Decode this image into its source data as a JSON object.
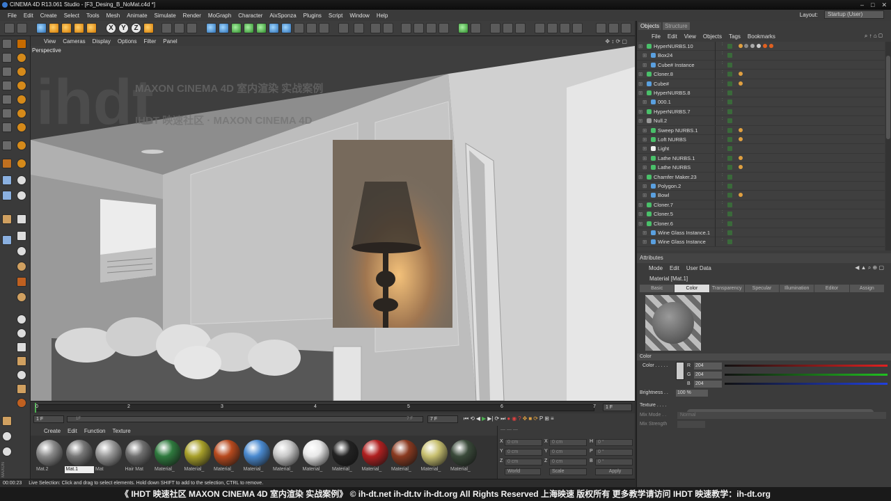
{
  "window": {
    "title": "CINEMA 4D R13.061 Studio - [F3_Desing_B_NoMat.c4d *]"
  },
  "menubar": [
    "File",
    "Edit",
    "Create",
    "Select",
    "Tools",
    "Mesh",
    "Animate",
    "Simulate",
    "Render",
    "MoGraph",
    "Character",
    "AixSponza",
    "Plugins",
    "Script",
    "Window",
    "Help"
  ],
  "layout": {
    "label": "Layout:",
    "value": "Startup (User)"
  },
  "viewport": {
    "menu": [
      "View",
      "Cameras",
      "Display",
      "Options",
      "Filter",
      "Panel"
    ],
    "label": "Perspective",
    "overlay_logo": "ihdt",
    "overlay_line1": "MAXON CINEMA 4D 室内渲染 实战案例",
    "overlay_line2": "IHDT 映速社区 · MAXON CINEMA 4D"
  },
  "timeline": {
    "ticks": [
      "0",
      "2",
      "3",
      "4",
      "5",
      "6",
      "7"
    ],
    "end_field": "1 F"
  },
  "transport": {
    "start_field": "1 F",
    "current_field": "7 F",
    "slider_start": "1F",
    "slider_end": "7 F"
  },
  "material_manager": {
    "menu": [
      "Create",
      "Edit",
      "Function",
      "Texture"
    ],
    "materials": [
      {
        "label": "Mat.2",
        "color": "#8a8a8a"
      },
      {
        "label": "Mat.1",
        "color": "#777"
      },
      {
        "label": "Mat",
        "color": "#999"
      },
      {
        "label": "Hair Mat",
        "color": "#6f6f6f"
      },
      {
        "label": "Material_",
        "color": "#2f7a3e"
      },
      {
        "label": "Material_",
        "color": "#a8a02a"
      },
      {
        "label": "Material_",
        "color": "#b84a1e"
      },
      {
        "label": "Material_",
        "color": "#4a8ad0"
      },
      {
        "label": "Material_",
        "color": "#c8c8c8"
      },
      {
        "label": "Material_",
        "color": "#e8e8e8"
      },
      {
        "label": "Material_",
        "color": "#222"
      },
      {
        "label": "Material_",
        "color": "#b02020"
      },
      {
        "label": "Material_",
        "color": "#8a3a20"
      },
      {
        "label": "Material_",
        "color": "#c8c070"
      },
      {
        "label": "Material_",
        "color": "#3a4a3a"
      }
    ],
    "selected_index": 1
  },
  "coords": {
    "rows": [
      {
        "a": "X",
        "b": "X",
        "c": "H"
      },
      {
        "a": "Y",
        "b": "Y",
        "c": "P"
      },
      {
        "a": "Z",
        "b": "Z",
        "c": "B"
      }
    ],
    "world": "World",
    "scale": "Scale",
    "apply": "Apply"
  },
  "status": {
    "time": "00:00:23",
    "text": "Live Selection: Click and drag to select elements. Hold down SHIFT to add to the selection, CTRL to remove."
  },
  "objects_panel": {
    "tabs": [
      "Objects",
      "Structure"
    ],
    "menu": [
      "File",
      "Edit",
      "View",
      "Objects",
      "Tags",
      "Bookmarks"
    ],
    "items": [
      {
        "name": "HyperNURBS.10",
        "depth": 0,
        "icon": "#4ac06a"
      },
      {
        "name": "Box24",
        "depth": 1,
        "icon": "#5aa0e0"
      },
      {
        "name": "Cube# Instance",
        "depth": 1,
        "icon": "#5aa0e0"
      },
      {
        "name": "Cloner.8",
        "depth": 0,
        "icon": "#4ac06a"
      },
      {
        "name": "Cube#",
        "depth": 0,
        "icon": "#5aa0e0"
      },
      {
        "name": "HyperNURBS.8",
        "depth": 0,
        "icon": "#4ac06a"
      },
      {
        "name": "000.1",
        "depth": 1,
        "icon": "#5aa0e0"
      },
      {
        "name": "HyperNURBS.7",
        "depth": 0,
        "icon": "#4ac06a"
      },
      {
        "name": "Null.2",
        "depth": 0,
        "icon": "#999"
      },
      {
        "name": "Sweep NURBS.1",
        "depth": 1,
        "icon": "#4ac06a"
      },
      {
        "name": "Loft NURBS",
        "depth": 1,
        "icon": "#4ac06a"
      },
      {
        "name": "Light",
        "depth": 1,
        "icon": "#eee"
      },
      {
        "name": "Lathe NURBS.1",
        "depth": 1,
        "icon": "#4ac06a"
      },
      {
        "name": "Lathe NURBS",
        "depth": 1,
        "icon": "#4ac06a"
      },
      {
        "name": "Chamfer Maker.23",
        "depth": 0,
        "icon": "#4ac06a"
      },
      {
        "name": "Polygon.2",
        "depth": 1,
        "icon": "#5aa0e0"
      },
      {
        "name": "Bowl",
        "depth": 1,
        "icon": "#5aa0e0"
      },
      {
        "name": "Cloner.7",
        "depth": 0,
        "icon": "#4ac06a"
      },
      {
        "name": "Cloner.5",
        "depth": 0,
        "icon": "#4ac06a"
      },
      {
        "name": "Cloner.6",
        "depth": 0,
        "icon": "#4ac06a"
      },
      {
        "name": "Wine Glass Instance.1",
        "depth": 1,
        "icon": "#5aa0e0"
      },
      {
        "name": "Wine Glass Instance",
        "depth": 1,
        "icon": "#5aa0e0"
      }
    ]
  },
  "attributes_panel": {
    "header": "Attributes",
    "menu": [
      "Mode",
      "Edit",
      "User Data"
    ],
    "material_title": "Material [Mat.1]",
    "tabs": [
      "Basic",
      "Color",
      "Transparency",
      "Specular",
      "Illumination",
      "Editor",
      "Assign"
    ],
    "active_tab": "Color",
    "section": "Color",
    "color_label": "Color . . . . .",
    "r": "204",
    "g": "204",
    "b": "204",
    "r_label": "R",
    "g_label": "G",
    "b_label": "B",
    "brightness_label": "Brightness . .",
    "brightness": "100 %",
    "texture_label": "Texture . . . .",
    "mix_mode_label": "Mix Mode . .",
    "mix_mode": "Normal",
    "mix_strength_label": "Mix Strength"
  },
  "watermark": "《 IHDT 映速社区 MAXON CINEMA 4D 室内渲染 实战案例》  © ih-dt.net ih-dt.tv  ih-dt.org  All Rights Reserved 上海映速 版权所有    更多教学请访问 IHDT 映速教学：ih-dt.org"
}
